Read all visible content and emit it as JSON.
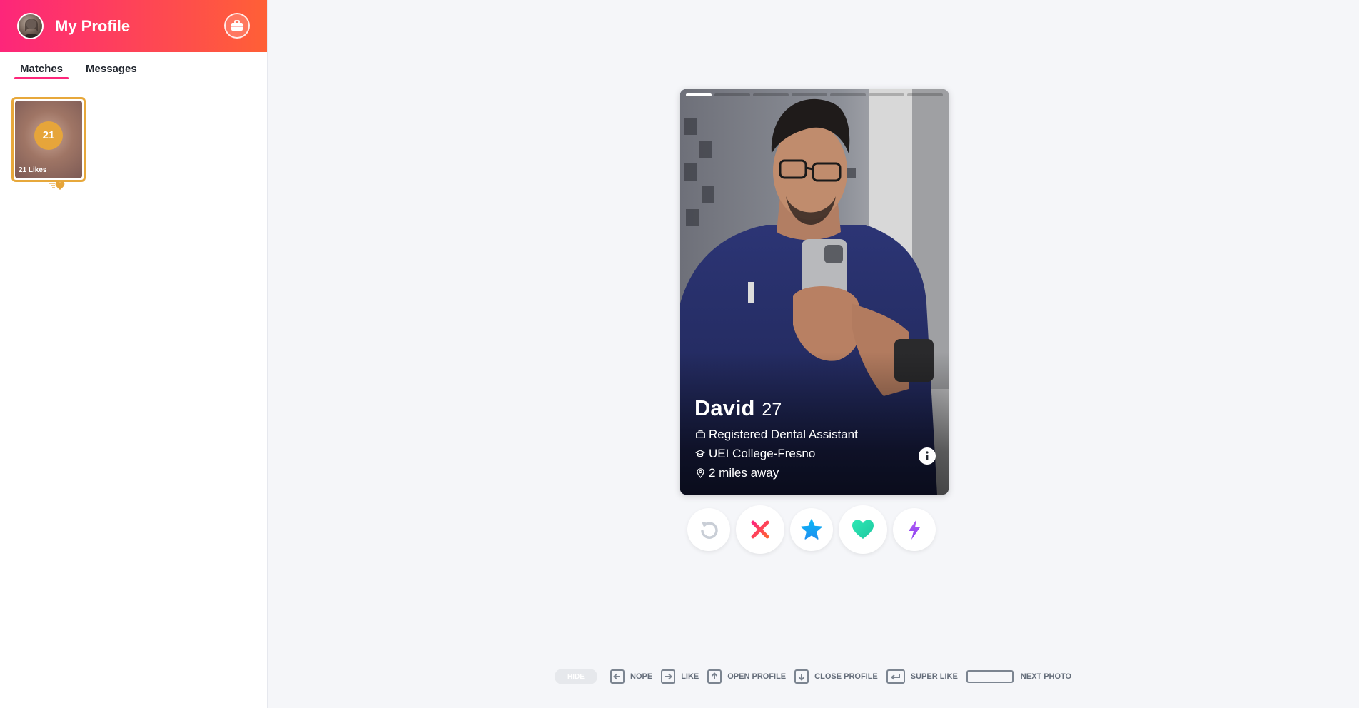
{
  "header": {
    "title": "My Profile",
    "brand_gradient": [
      "#fd267a",
      "#ff6036"
    ],
    "right_icon": "briefcase-icon"
  },
  "tabs": [
    {
      "label": "Matches",
      "active": true
    },
    {
      "label": "Messages",
      "active": false
    }
  ],
  "likes_card": {
    "count": "21",
    "label": "21 Likes",
    "accent": "#e7a83b"
  },
  "profile": {
    "name": "David",
    "age": "27",
    "job": "Registered Dental Assistant",
    "school": "UEI College-Fresno",
    "distance": "2 miles away",
    "photo_index": 1,
    "photo_count": 7
  },
  "actions": [
    {
      "name": "rewind-button",
      "icon": "rewind-icon"
    },
    {
      "name": "nope-button",
      "icon": "x-icon"
    },
    {
      "name": "super-like-button",
      "icon": "star-icon"
    },
    {
      "name": "like-button",
      "icon": "heart-icon"
    },
    {
      "name": "boost-button",
      "icon": "lightning-icon"
    }
  ],
  "shortcuts": {
    "hide": "HIDE",
    "nope": "NOPE",
    "like": "LIKE",
    "open_profile": "OPEN PROFILE",
    "close_profile": "CLOSE PROFILE",
    "super_like": "SUPER LIKE",
    "next_photo": "NEXT PHOTO"
  }
}
